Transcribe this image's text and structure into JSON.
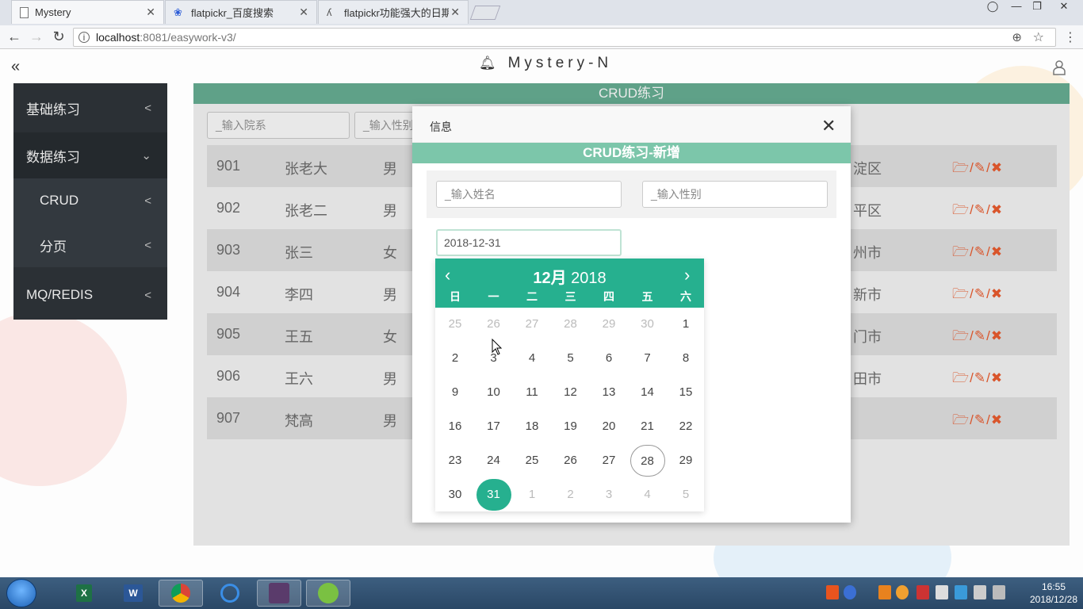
{
  "browser": {
    "tabs": [
      {
        "title": "Mystery",
        "active": true
      },
      {
        "title": "flatpickr_百度搜索",
        "active": false
      },
      {
        "title": "flatpickr功能强大的日期",
        "active": false
      }
    ],
    "url_host": "localhost",
    "url_path": ":8081/easywork-v3/"
  },
  "header": {
    "brand": "Mystery-N"
  },
  "sidebar": {
    "items": [
      {
        "label": "基础练习"
      },
      {
        "label": "数据练习"
      },
      {
        "label": "CRUD"
      },
      {
        "label": "分页"
      },
      {
        "label": "MQ/REDIS"
      }
    ]
  },
  "content": {
    "title": "CRUD练习",
    "filters": {
      "department_placeholder": "_输入院系",
      "gender_placeholder": "_输入性别"
    },
    "rows": [
      {
        "id": "901",
        "name": "张老大",
        "gender": "男",
        "city": "淀区"
      },
      {
        "id": "902",
        "name": "张老二",
        "gender": "男",
        "city": "平区"
      },
      {
        "id": "903",
        "name": "张三",
        "gender": "女",
        "city": "州市"
      },
      {
        "id": "904",
        "name": "李四",
        "gender": "男",
        "city": "新市"
      },
      {
        "id": "905",
        "name": "王五",
        "gender": "女",
        "city": "门市"
      },
      {
        "id": "906",
        "name": "王六",
        "gender": "男",
        "city": "田市"
      },
      {
        "id": "907",
        "name": "梵高",
        "gender": "男",
        "city": ""
      }
    ]
  },
  "modal": {
    "title": "信息",
    "subtitle": "CRUD练习-新增",
    "name_placeholder": "_输入姓名",
    "gender_placeholder": "_输入性别",
    "date_value": "2018-12-31"
  },
  "calendar": {
    "month": "12月",
    "year": "2018",
    "weekdays": [
      "日",
      "一",
      "二",
      "三",
      "四",
      "五",
      "六"
    ],
    "weeks": [
      [
        "25",
        "26",
        "27",
        "28",
        "29",
        "30",
        "1"
      ],
      [
        "2",
        "3",
        "4",
        "5",
        "6",
        "7",
        "8"
      ],
      [
        "9",
        "10",
        "11",
        "12",
        "13",
        "14",
        "15"
      ],
      [
        "16",
        "17",
        "18",
        "19",
        "20",
        "21",
        "22"
      ],
      [
        "23",
        "24",
        "25",
        "26",
        "27",
        "28",
        "29"
      ],
      [
        "30",
        "31",
        "1",
        "2",
        "3",
        "4",
        "5"
      ]
    ],
    "today": "28",
    "selected": "31"
  },
  "taskbar": {
    "time": "16:55",
    "date": "2018/12/28"
  },
  "colors": {
    "accent": "#26b08f",
    "header_green": "#5fa188",
    "action_red": "#d9552b"
  }
}
